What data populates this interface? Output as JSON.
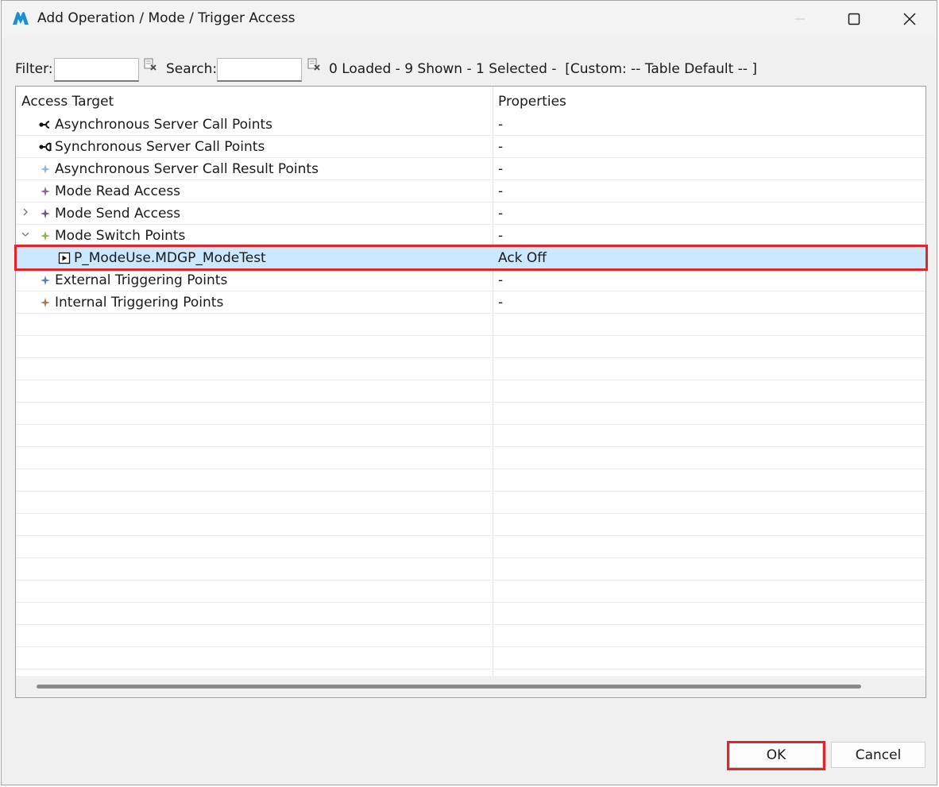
{
  "window": {
    "title": "Add Operation / Mode / Trigger Access",
    "brand_color": "#1a8fd6"
  },
  "toolbar": {
    "filter_label": "Filter:",
    "filter_value": "",
    "search_label": "Search:",
    "search_value": "",
    "status": "0 Loaded - 9 Shown - 1 Selected -  [Custom: -- Table Default -- ]"
  },
  "table": {
    "columns": [
      "Access Target",
      "Properties"
    ],
    "rows": [
      {
        "label": "Asynchronous Server Call Points",
        "props": "-",
        "icon": "async-server-call-icon",
        "depth": 0,
        "expander": ""
      },
      {
        "label": "Synchronous Server Call Points",
        "props": "-",
        "icon": "sync-server-call-icon",
        "depth": 0,
        "expander": ""
      },
      {
        "label": "Asynchronous Server Call Result Points",
        "props": "-",
        "icon": "result-point-icon",
        "depth": 0,
        "expander": ""
      },
      {
        "label": "Mode Read Access",
        "props": "-",
        "icon": "mode-read-icon",
        "depth": 0,
        "expander": ""
      },
      {
        "label": "Mode Send Access",
        "props": "-",
        "icon": "mode-send-icon",
        "depth": 0,
        "expander": "collapsed"
      },
      {
        "label": "Mode Switch Points",
        "props": "-",
        "icon": "mode-switch-icon",
        "depth": 0,
        "expander": "expanded"
      },
      {
        "label": "P_ModeUse.MDGP_ModeTest",
        "props": "Ack Off",
        "icon": "port-icon",
        "depth": 1,
        "expander": "",
        "selected": true
      },
      {
        "label": "External Triggering Points",
        "props": "-",
        "icon": "external-trigger-icon",
        "depth": 0,
        "expander": ""
      },
      {
        "label": "Internal Triggering Points",
        "props": "-",
        "icon": "internal-trigger-icon",
        "depth": 0,
        "expander": ""
      }
    ]
  },
  "buttons": {
    "ok": "OK",
    "cancel": "Cancel"
  },
  "colors": {
    "selection": "#cce8ff",
    "highlight": "#e0262b"
  }
}
